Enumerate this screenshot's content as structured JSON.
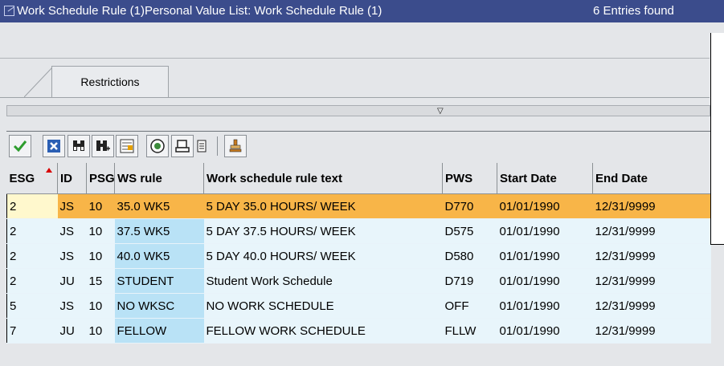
{
  "window": {
    "title": "Work Schedule Rule (1)Personal Value List: Work Schedule Rule (1)",
    "entries": "6 Entries found"
  },
  "tabs": [
    {
      "label": "Restrictions"
    }
  ],
  "toolbar": {
    "buttons": [
      {
        "icon": "checkmark-icon"
      },
      {
        "icon": "cancel-icon"
      },
      {
        "icon": "find-icon"
      },
      {
        "icon": "find-next-icon"
      },
      {
        "icon": "sort-icon"
      },
      {
        "icon": "information-icon"
      },
      {
        "icon": "print-icon"
      },
      {
        "icon": "document-icon"
      },
      {
        "icon": "personal-list-icon"
      }
    ]
  },
  "table": {
    "columns": [
      "ESG",
      "ID",
      "PSG",
      "WS rule",
      "Work schedule rule text",
      "PWS",
      "Start Date",
      "End Date"
    ],
    "rows": [
      [
        "2",
        "JS",
        "10",
        "35.0 WK5",
        "5 DAY 35.0 HOURS/ WEEK",
        "D770",
        "01/01/1990",
        "12/31/9999"
      ],
      [
        "2",
        "JS",
        "10",
        "37.5 WK5",
        "5 DAY 37.5 HOURS/ WEEK",
        "D575",
        "01/01/1990",
        "12/31/9999"
      ],
      [
        "2",
        "JS",
        "10",
        "40.0 WK5",
        "5 DAY 40.0 HOURS/ WEEK",
        "D580",
        "01/01/1990",
        "12/31/9999"
      ],
      [
        "2",
        "JU",
        "15",
        "STUDENT",
        "Student Work Schedule",
        "D719",
        "01/01/1990",
        "12/31/9999"
      ],
      [
        "5",
        "JS",
        "10",
        "NO WKSC",
        "NO WORK SCHEDULE",
        "OFF",
        "01/01/1990",
        "12/31/9999"
      ],
      [
        "7",
        "JU",
        "10",
        "FELLOW",
        "FELLOW WORK SCHEDULE",
        "FLLW",
        "01/01/1990",
        "12/31/9999"
      ]
    ]
  },
  "colors": {
    "titlebar": "#3b4c8c",
    "selected_row": "#f8b548",
    "row": "#e8f5fb",
    "ws_column": "#b9e2f6"
  }
}
